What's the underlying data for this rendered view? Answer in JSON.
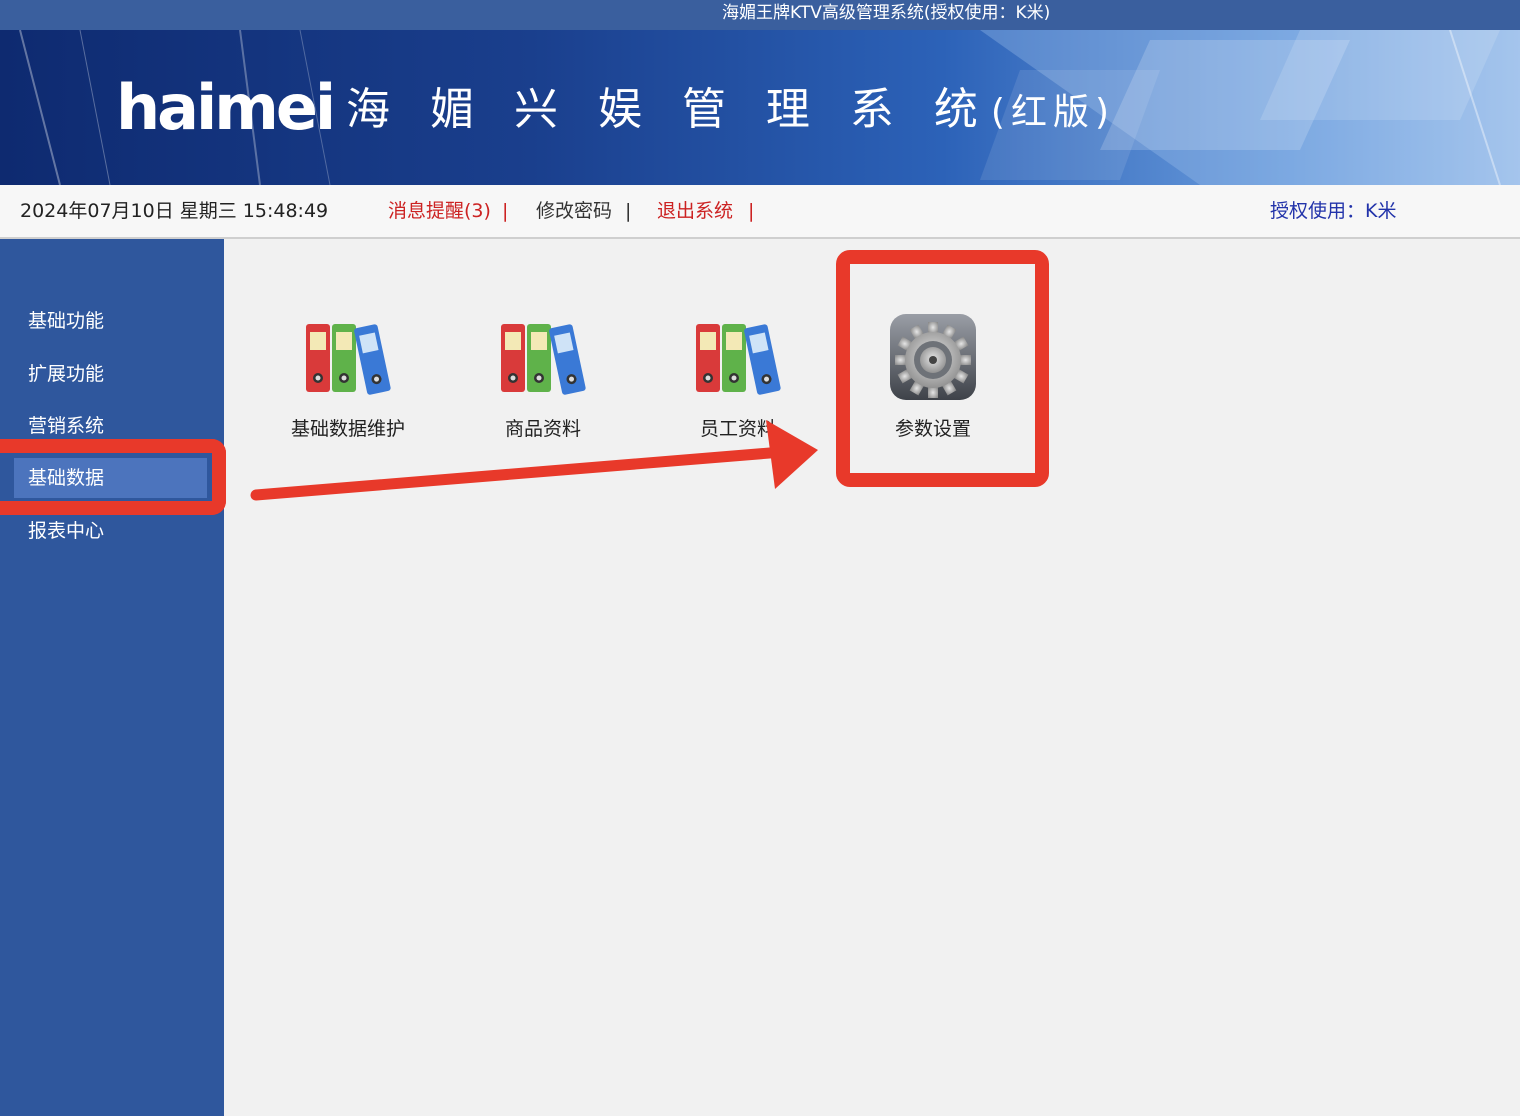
{
  "window": {
    "title": "海媚王牌KTV高级管理系统(授权使用：K米)"
  },
  "banner": {
    "logo": "haimei",
    "system_name": "海 媚 兴 娱 管 理 系 统",
    "edition": "(红版)"
  },
  "infobar": {
    "datetime": "2024年07月10日 星期三 15:48:49",
    "message_link": "消息提醒(3)",
    "separator": "|",
    "change_password": "修改密码",
    "logout": "退出系统",
    "license": "授权使用：K米"
  },
  "sidebar": {
    "items": [
      {
        "label": "基础功能"
      },
      {
        "label": "扩展功能"
      },
      {
        "label": "营销系统"
      },
      {
        "label": "基础数据",
        "selected": true
      },
      {
        "label": "报表中心"
      }
    ]
  },
  "tiles": [
    {
      "label": "基础数据维护",
      "icon": "binders-icon"
    },
    {
      "label": "商品资料",
      "icon": "binders-icon"
    },
    {
      "label": "员工资料",
      "icon": "binders-icon"
    },
    {
      "label": "参数设置",
      "icon": "gear-icon"
    }
  ],
  "colors": {
    "annotation": "#e8392a",
    "sidebar": "#2f579d",
    "sidebar_active": "#4c74bd",
    "titlebar": "#3a5f9e",
    "alert_text": "#cc2222",
    "license_text": "#2233aa"
  }
}
